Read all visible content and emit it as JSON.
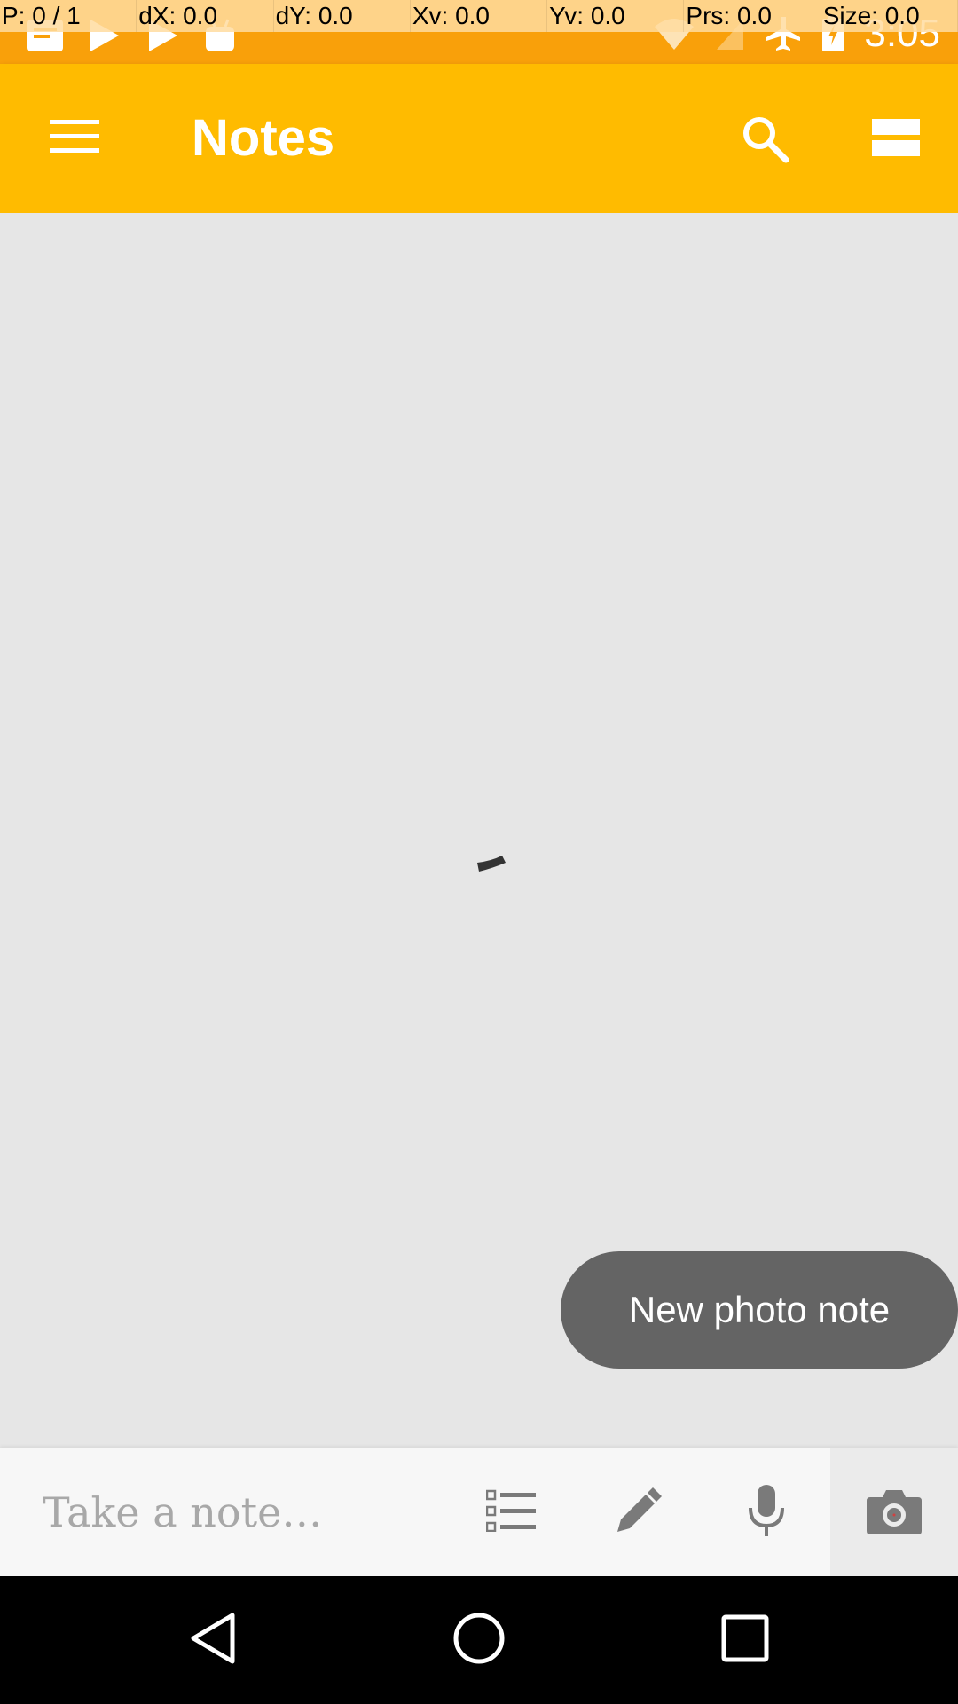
{
  "status_bar": {
    "pointer_info": [
      "P: 0 / 1",
      "dX: 0.0",
      "dY: 0.0",
      "Xv: 0.0",
      "Yv: 0.0",
      "Prs: 0.0",
      "Size: 0.0"
    ],
    "time": "3:05",
    "left_icons": [
      "notes-icon",
      "play-store-icon",
      "play-store-icon",
      "android-icon"
    ],
    "right_icons": [
      "wifi-icon",
      "no-sim-icon",
      "airplane-mode-icon",
      "battery-charging-icon"
    ],
    "background_color": "#f9a00a"
  },
  "app_bar": {
    "title": "Notes",
    "background_color": "#ffbb00",
    "icons": [
      "menu-icon",
      "search-icon",
      "single-column-view-icon"
    ]
  },
  "content": {
    "state": "loading",
    "background_color": "#e6e6e6"
  },
  "toast": {
    "text": "New photo note",
    "background_color": "#646464"
  },
  "bottom_bar": {
    "placeholder": "Take a note…",
    "icons": [
      "list-icon",
      "pen-icon",
      "microphone-icon",
      "camera-icon"
    ]
  },
  "nav_bar": {
    "icons": [
      "back-icon",
      "home-icon",
      "recents-icon"
    ]
  }
}
